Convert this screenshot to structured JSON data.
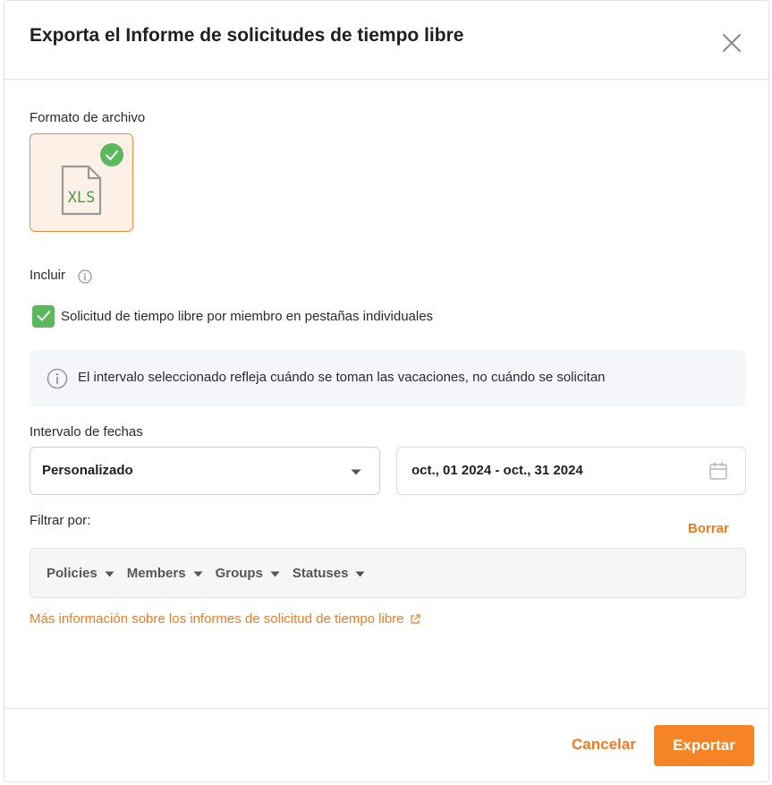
{
  "dialog": {
    "title": "Exporta el Informe de solicitudes de tiempo libre"
  },
  "file_format": {
    "label": "Formato de archivo",
    "option": "XLS",
    "selected": true
  },
  "include": {
    "label": "Incluir",
    "checkbox_label": "Solicitud de tiempo libre por miembro en pestañas individuales",
    "checked": true
  },
  "notice": {
    "text": "El intervalo seleccionado refleja cuándo se toman las vacaciones, no cuándo se solicitan"
  },
  "date_range": {
    "label": "Intervalo de fechas",
    "selected": "Personalizado",
    "value": "oct., 01 2024 - oct., 31 2024"
  },
  "filters": {
    "label": "Filtrar por:",
    "clear_label": "Borrar",
    "items": [
      {
        "label": "Policies"
      },
      {
        "label": "Members"
      },
      {
        "label": "Groups"
      },
      {
        "label": "Statuses"
      }
    ]
  },
  "more_info": {
    "label": "Más información sobre los informes de solicitud de tiempo libre"
  },
  "footer": {
    "cancel_label": "Cancelar",
    "export_label": "Exportar"
  },
  "colors": {
    "accent": "#f58426",
    "success": "#5cb85c",
    "notice_bg": "#f4f6fa"
  }
}
